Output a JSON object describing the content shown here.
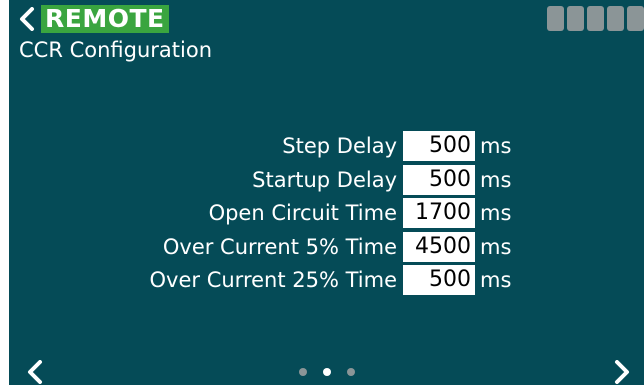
{
  "header": {
    "mode_badge": "REMOTE",
    "title": "CCR Configuration",
    "status_block_count": 5
  },
  "form": {
    "rows": [
      {
        "label": "Step Delay",
        "value": "500",
        "unit": "ms"
      },
      {
        "label": "Startup Delay",
        "value": "500",
        "unit": "ms"
      },
      {
        "label": "Open Circuit Time",
        "value": "1700",
        "unit": "ms"
      },
      {
        "label": "Over Current 5% Time",
        "value": "4500",
        "unit": "ms"
      },
      {
        "label": "Over Current 25% Time",
        "value": "500",
        "unit": "ms"
      }
    ]
  },
  "pager": {
    "page_count": 3,
    "current_page": 2
  },
  "icons": {
    "back": "chevron-left-icon",
    "prev": "chevron-left-icon",
    "next": "chevron-right-icon"
  },
  "colors": {
    "background": "#054b57",
    "badge": "#3aa53f",
    "inactive": "#8b9597"
  }
}
